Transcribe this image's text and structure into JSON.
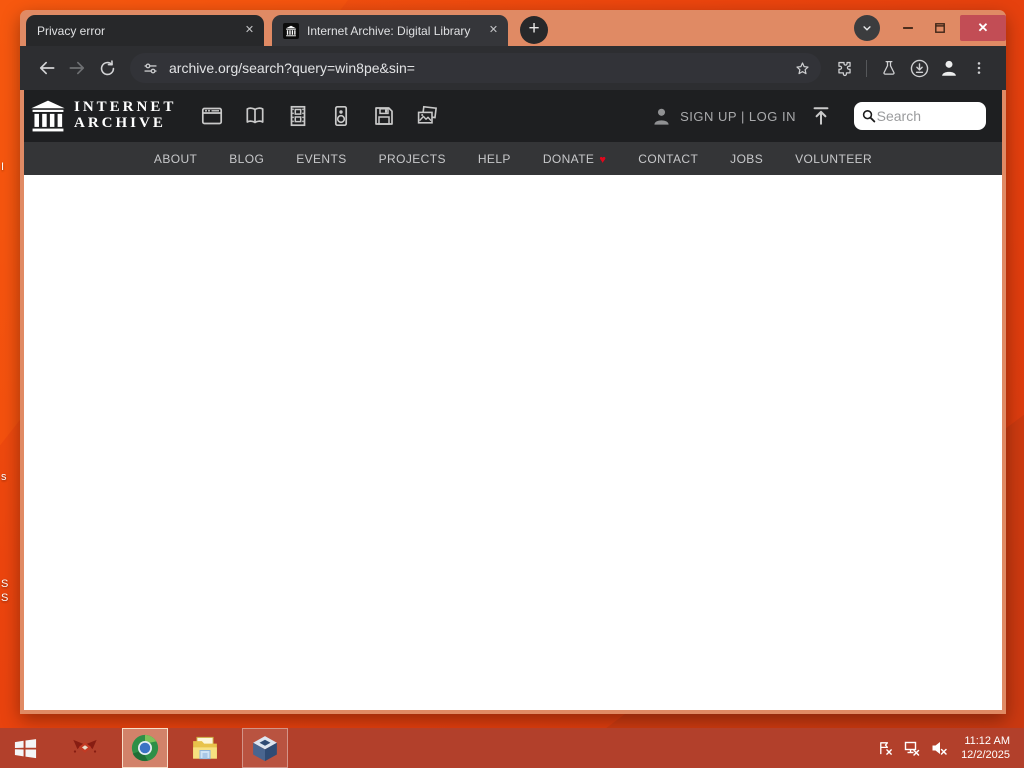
{
  "desktop": {
    "label_fragments": [
      "I",
      "s",
      "S",
      "S"
    ]
  },
  "browser": {
    "tabs": [
      {
        "title": "Privacy error"
      },
      {
        "title": "Internet Archive: Digital Library"
      }
    ],
    "tab_close_glyph": "✕",
    "new_tab_glyph": "+",
    "window_close_glyph": "✕",
    "omnibox": {
      "url": "archive.org/search?query=win8pe&sin="
    }
  },
  "ia": {
    "wordmark_line1": "INTERNET",
    "wordmark_line2": "ARCHIVE",
    "signup_login": "SIGN UP | LOG IN",
    "search_placeholder": "Search",
    "donate_heart_glyph": "♥",
    "nav_items": [
      "ABOUT",
      "BLOG",
      "EVENTS",
      "PROJECTS",
      "HELP",
      "DONATE",
      "CONTACT",
      "JOBS",
      "VOLUNTEER"
    ]
  },
  "taskbar": {
    "time": "11:12 AM",
    "date": "12/2/2025"
  },
  "colors": {
    "frame_salmon": "#e08a64",
    "desktop_orange": "#e8420e",
    "taskbar_red": "#b2402b",
    "close_button_red": "#c24d55",
    "heart_red": "#e2071c",
    "toolbar_dark": "#2d2e31",
    "header_dark": "#1e1f21"
  }
}
